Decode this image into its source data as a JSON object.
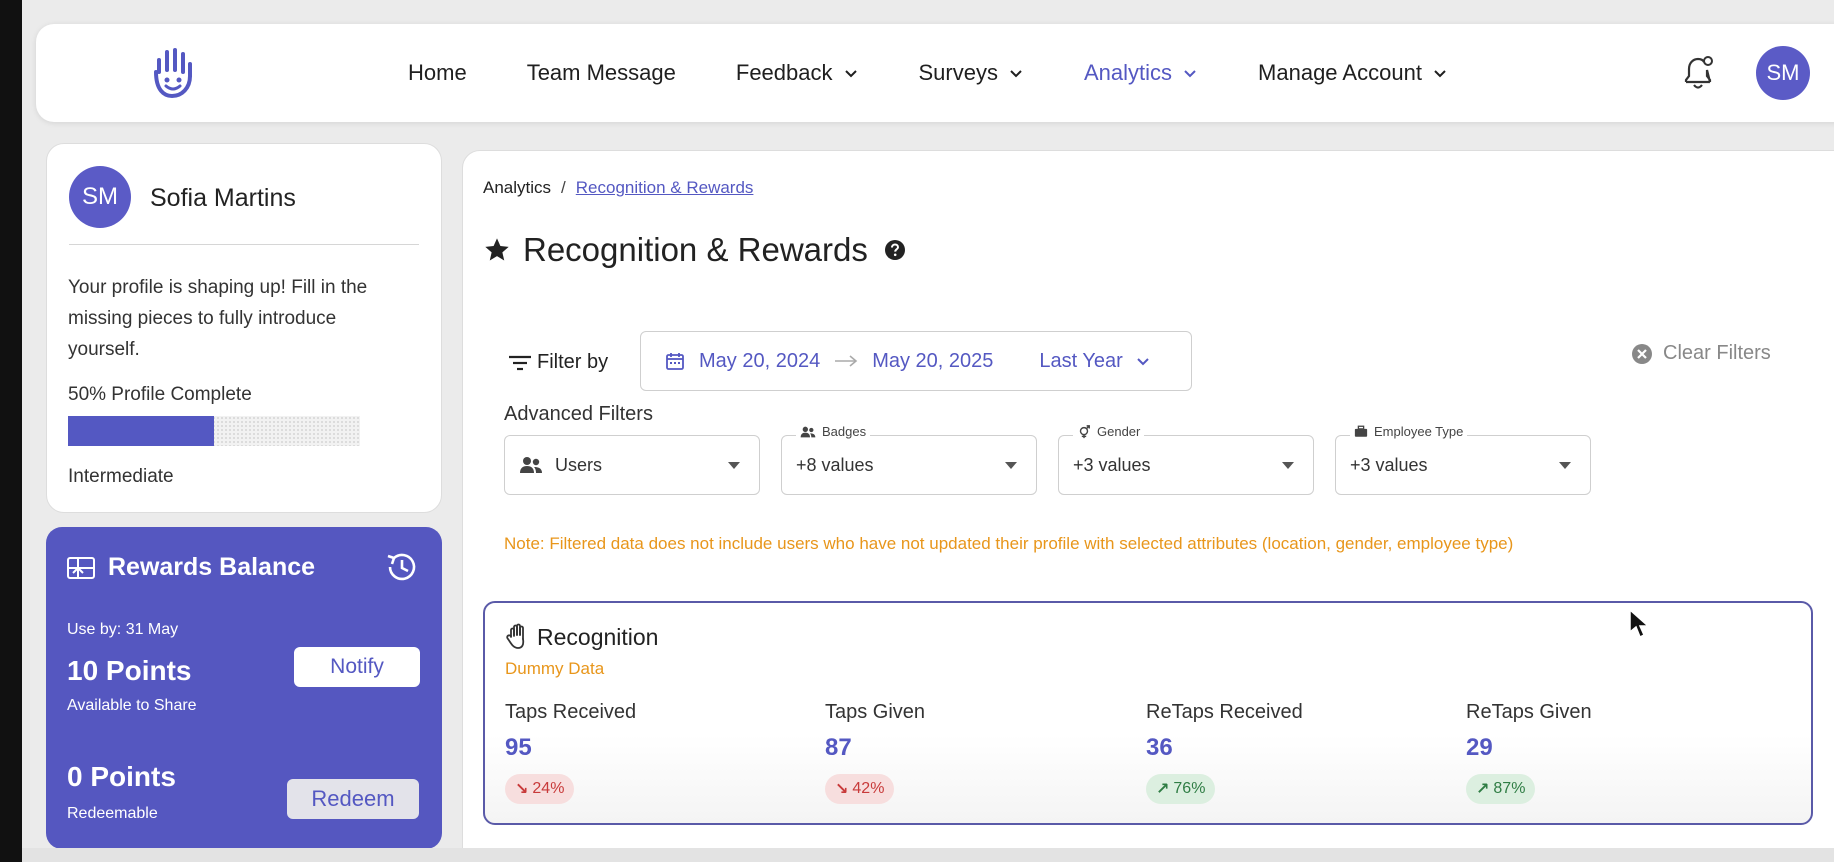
{
  "colors": {
    "accent": "#5458c2",
    "warning": "#e8961b",
    "down": "#c83a3a",
    "up": "#2f7d44"
  },
  "nav": {
    "items": [
      {
        "label": "Home",
        "dropdown": false,
        "active": false
      },
      {
        "label": "Team Message",
        "dropdown": false,
        "active": false
      },
      {
        "label": "Feedback",
        "dropdown": true,
        "active": false
      },
      {
        "label": "Surveys",
        "dropdown": true,
        "active": false
      },
      {
        "label": "Analytics",
        "dropdown": true,
        "active": true
      },
      {
        "label": "Manage Account",
        "dropdown": true,
        "active": false
      }
    ],
    "avatar": "SM",
    "icons": {
      "logo": "hand-logo-icon",
      "notifications": "bell-icon"
    }
  },
  "profile": {
    "initials": "SM",
    "name": "Sofia Martins",
    "message": "Your profile is shaping up! Fill in the missing pieces to fully introduce yourself.",
    "complete_label": "50% Profile Complete",
    "complete_fraction": 0.5,
    "level": "Intermediate"
  },
  "rewards": {
    "title": "Rewards Balance",
    "use_by": "Use by: 31 May",
    "share_points": "10 Points",
    "share_caption": "Available to Share",
    "notify_label": "Notify",
    "redeem_points": "0 Points",
    "redeem_caption": "Redeemable",
    "redeem_label": "Redeem"
  },
  "breadcrumb": {
    "root": "Analytics",
    "separator": "/",
    "current": "Recognition & Rewards"
  },
  "page": {
    "title": "Recognition & Rewards"
  },
  "filters": {
    "filter_by": "Filter by",
    "date_start": "May 20, 2024",
    "date_end": "May 20, 2025",
    "preset": "Last Year",
    "clear": "Clear Filters",
    "advanced_label": "Advanced Filters",
    "selects": [
      {
        "floating_label": "",
        "value": "Users"
      },
      {
        "floating_label": "Badges",
        "value": "+8 values"
      },
      {
        "floating_label": "Gender",
        "value": "+3 values"
      },
      {
        "floating_label": "Employee Type",
        "value": "+3 values"
      }
    ],
    "note": "Note: Filtered data does not include users who have not updated their profile with selected attributes (location, gender, employee type)"
  },
  "recognition": {
    "title": "Recognition",
    "subtitle": "Dummy Data",
    "metrics": [
      {
        "label": "Taps Received",
        "value": "95",
        "change": "24%",
        "direction": "down"
      },
      {
        "label": "Taps Given",
        "value": "87",
        "change": "42%",
        "direction": "down"
      },
      {
        "label": "ReTaps Received",
        "value": "36",
        "change": "76%",
        "direction": "up"
      },
      {
        "label": "ReTaps Given",
        "value": "29",
        "change": "87%",
        "direction": "up"
      }
    ]
  }
}
